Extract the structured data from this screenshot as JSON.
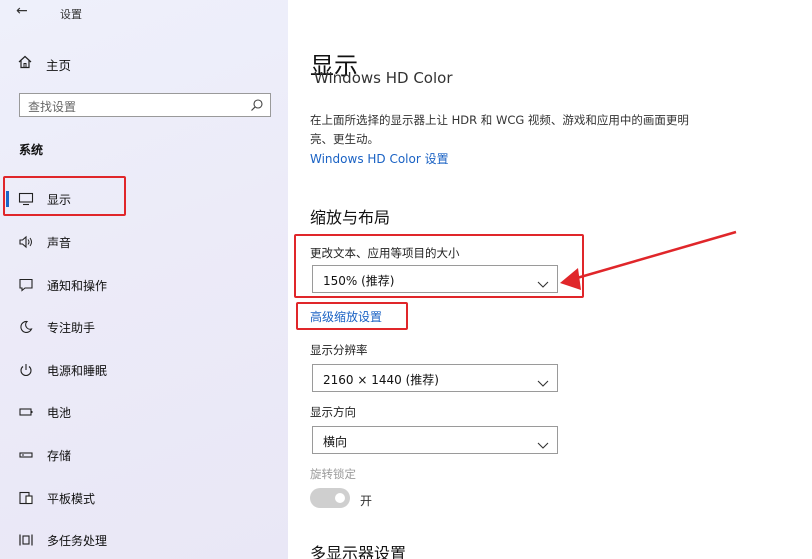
{
  "window": {
    "title": "设置"
  },
  "sidebar": {
    "home_label": "主页",
    "search_placeholder": "查找设置",
    "section": "系统",
    "items": [
      {
        "label": "显示",
        "icon": "monitor-icon",
        "active": true
      },
      {
        "label": "声音",
        "icon": "speaker-icon"
      },
      {
        "label": "通知和操作",
        "icon": "notification-icon"
      },
      {
        "label": "专注助手",
        "icon": "moon-icon"
      },
      {
        "label": "电源和睡眠",
        "icon": "power-icon"
      },
      {
        "label": "电池",
        "icon": "battery-icon"
      },
      {
        "label": "存储",
        "icon": "storage-icon"
      },
      {
        "label": "平板模式",
        "icon": "tablet-icon"
      },
      {
        "label": "多任务处理",
        "icon": "multitask-icon"
      }
    ]
  },
  "main": {
    "page_title": "显示",
    "hdr": {
      "heading_fragment": "Windows HD Color",
      "description": "在上面所选择的显示器上让 HDR 和 WCG 视频、游戏和应用中的画面更明亮、更生动。",
      "link": "Windows HD Color 设置"
    },
    "scale_layout": {
      "heading": "缩放与布局",
      "scale_label": "更改文本、应用等项目的大小",
      "scale_value": "150% (推荐)",
      "advanced_link": "高级缩放设置",
      "resolution_label": "显示分辨率",
      "resolution_value": "2160 × 1440 (推荐)",
      "orientation_label": "显示方向",
      "orientation_value": "横向",
      "rotation_lock_label": "旋转锁定",
      "rotation_lock_state": "开"
    },
    "multi_display_heading": "多显示器设置"
  },
  "colors": {
    "accent": "#1a62c4",
    "highlight_red": "#e0262a",
    "sidebar_bg": "#eceaf8"
  }
}
